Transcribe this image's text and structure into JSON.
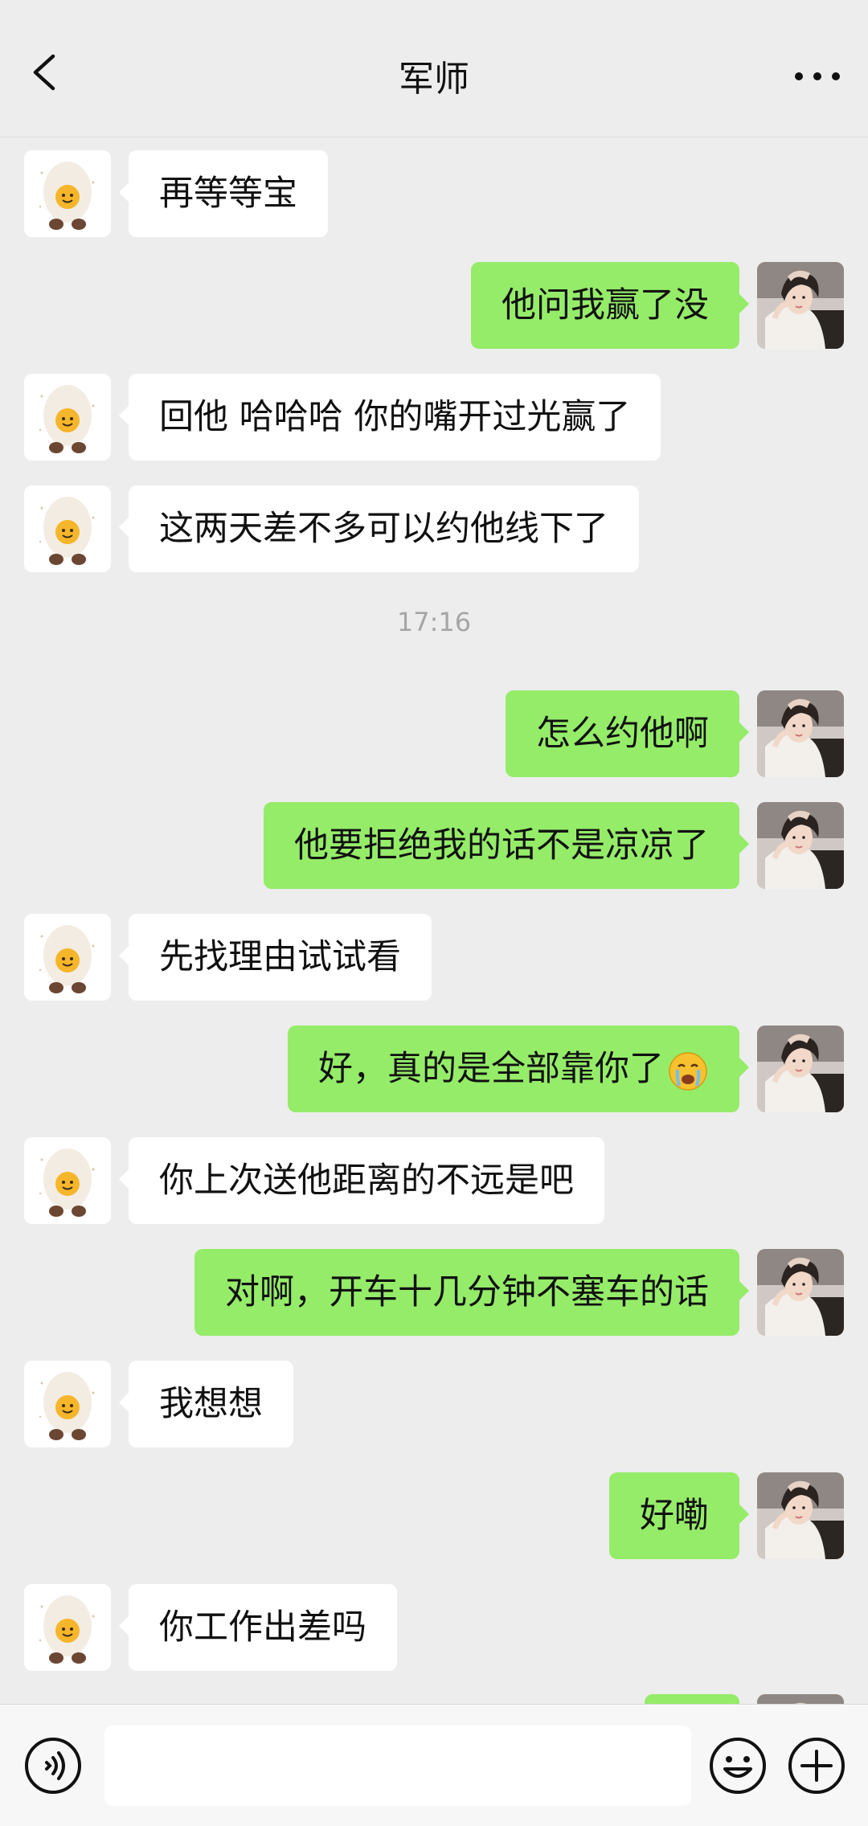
{
  "header": {
    "title": "军师"
  },
  "timestamp": "17:16",
  "messages": [
    {
      "side": "in",
      "text": "再等等宝"
    },
    {
      "side": "out",
      "text": "他问我赢了没"
    },
    {
      "side": "in",
      "text": "回他 哈哈哈 你的嘴开过光赢了"
    },
    {
      "side": "in",
      "text": "这两天差不多可以约他线下了"
    },
    {
      "side": "out",
      "text": "怎么约他啊"
    },
    {
      "side": "out",
      "text": "他要拒绝我的话不是凉凉了"
    },
    {
      "side": "in",
      "text": "先找理由试试看"
    },
    {
      "side": "out",
      "text": "好，真的是全部靠你了"
    },
    {
      "side": "in",
      "text": "你上次送他距离的不远是吧"
    },
    {
      "side": "out",
      "text": "对啊，开车十几分钟不塞车的话"
    },
    {
      "side": "in",
      "text": "我想想"
    },
    {
      "side": "out",
      "text": "好嘞"
    },
    {
      "side": "in",
      "text": "你工作出差吗"
    }
  ],
  "colors": {
    "incoming_bubble": "#FFFFFF",
    "outgoing_bubble": "#95EC69",
    "background": "#EDEDED"
  },
  "icons": {
    "back": "chevron-left-icon",
    "more": "ellipsis-icon",
    "voice": "voice-icon",
    "emoji": "smiley-icon",
    "plus": "plus-icon",
    "crying_emoji": "crying-face-emoji"
  },
  "input": {
    "value": "",
    "placeholder": ""
  }
}
